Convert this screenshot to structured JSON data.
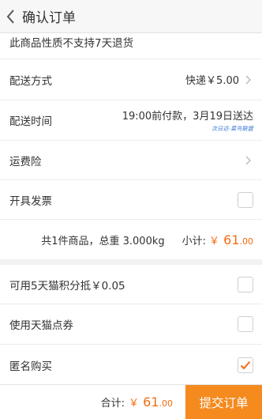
{
  "header": {
    "title": "确认订单"
  },
  "notice": "此商品性质不支持7天退货",
  "delivery": {
    "label": "配送方式",
    "value": "快递￥5.00"
  },
  "delivery_time": {
    "label": "配送时间",
    "value": "19:00前付款，3月19日送达",
    "badge": "次日达·菜鸟联盟"
  },
  "insurance": {
    "label": "运费险"
  },
  "invoice": {
    "label": "开具发票"
  },
  "summary": {
    "info": "共1件商品，总重 3.000kg",
    "subtotal_label": "小计:",
    "currency": "￥",
    "amount_int": "61",
    "amount_dec": ".00"
  },
  "options": [
    {
      "label": "可用5天猫积分抵￥0.05",
      "checked": false
    },
    {
      "label": "使用天猫点券",
      "checked": false
    },
    {
      "label": "匿名购买",
      "checked": true
    }
  ],
  "footer": {
    "total_label": "合计:",
    "currency": "￥",
    "amount_int": "61",
    "amount_dec": ".00",
    "submit_label": "提交订单"
  },
  "colors": {
    "accent": "#f46b10",
    "submit_bg": "#f58a1f",
    "badge": "#2e6fd7"
  }
}
